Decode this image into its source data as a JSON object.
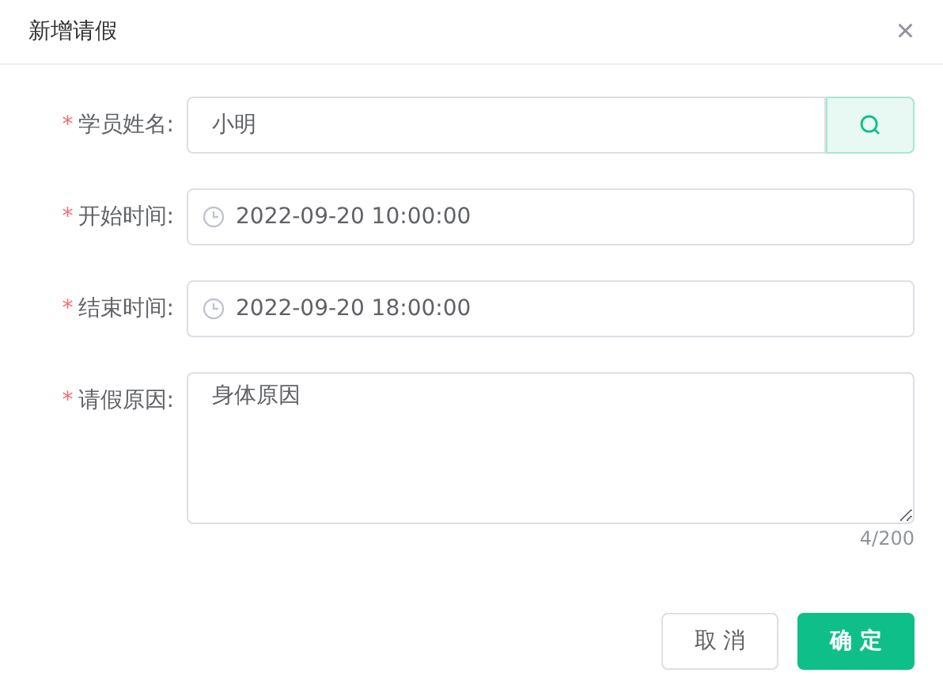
{
  "dialog": {
    "title": "新增请假",
    "close": "×",
    "required_mark": "*"
  },
  "fields": [
    {
      "kind": "search",
      "label": "学员姓名:",
      "required": true,
      "value": "小明"
    },
    {
      "kind": "datetime",
      "label": "开始时间:",
      "required": true,
      "value": "2022-09-20 10:00:00"
    },
    {
      "kind": "datetime",
      "label": "结束时间:",
      "required": true,
      "value": "2022-09-20 18:00:00"
    },
    {
      "kind": "textarea",
      "label": "请假原因:",
      "required": true,
      "value": "身体原因",
      "counter": "4/200"
    }
  ],
  "buttons": [
    {
      "label": "取 消",
      "kind": "secondary"
    },
    {
      "label": "确 定",
      "kind": "primary"
    }
  ]
}
